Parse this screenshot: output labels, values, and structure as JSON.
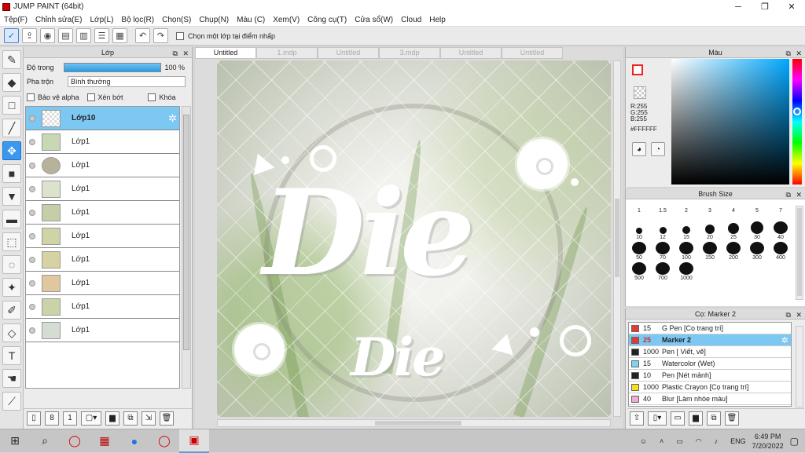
{
  "window": {
    "title": "JUMP PAINT (64bit)",
    "min": "─",
    "max": "❐",
    "close": "✕"
  },
  "menu": [
    "Tệp(F)",
    "Chỉnh sửa(E)",
    "Lớp(L)",
    "Bộ lọc(R)",
    "Chọn(S)",
    "Chụp(N)",
    "Màu (C)",
    "Xem(V)",
    "Công cụ(T)",
    "Cửa sổ(W)",
    "Cloud",
    "Help"
  ],
  "toolbar": {
    "select_layer_label": "Chọn một lớp tại điểm nhấp"
  },
  "layer_panel": {
    "title": "Lớp",
    "opacity_label": "Độ trong",
    "opacity_value": "100 %",
    "opacity": 100,
    "blend_label": "Pha trộn",
    "blend_value": "Bình thường",
    "protect_alpha": "Bảo vệ alpha",
    "clip": "Xén bớt",
    "lock": "Khóa",
    "layers": [
      {
        "name": "Lớp10",
        "active": true
      },
      {
        "name": "Lớp1"
      },
      {
        "name": "Lớp1"
      },
      {
        "name": "Lớp1"
      },
      {
        "name": "Lớp1"
      },
      {
        "name": "Lớp1"
      },
      {
        "name": "Lớp1"
      },
      {
        "name": "Lớp1"
      },
      {
        "name": "Lớp1"
      },
      {
        "name": "Lớp1"
      }
    ]
  },
  "tabs": [
    {
      "label": "Untitled",
      "active": true
    },
    {
      "label": "1.mdp"
    },
    {
      "label": "Untitled"
    },
    {
      "label": "3.mdp"
    },
    {
      "label": "Untitled"
    },
    {
      "label": "Untitled"
    }
  ],
  "canvas": {
    "main_text": "Die",
    "sub_text": "Die"
  },
  "color_panel": {
    "title": "Màu",
    "r": "R:255",
    "g": "G:255",
    "b": "B:255",
    "hex": "#FFFFFF"
  },
  "brush_panel": {
    "title": "Brush Size",
    "sizes": [
      "1",
      "1.5",
      "2",
      "3",
      "4",
      "5",
      "7",
      "10",
      "12",
      "15",
      "20",
      "25",
      "30",
      "40",
      "50",
      "70",
      "100",
      "150",
      "200",
      "300",
      "400",
      "500",
      "700",
      "1000"
    ]
  },
  "subtool_panel": {
    "title": "Cọ: Marker 2",
    "items": [
      {
        "size": "15",
        "name": "G Pen [Cọ trang trí]",
        "color": "#e53935"
      },
      {
        "size": "25",
        "name": "Marker 2",
        "color": "#e53935",
        "active": true
      },
      {
        "size": "1000",
        "name": "Pen [ Viết, vẽ]",
        "color": "#222222"
      },
      {
        "size": "15",
        "name": "Watercolor (Wet)",
        "color": "#7dd3f0"
      },
      {
        "size": "10",
        "name": "Pen [Nét mảnh]",
        "color": "#222222"
      },
      {
        "size": "1000",
        "name": "Plastic Crayon [Cọ trang trí]",
        "color": "#f2e01d"
      },
      {
        "size": "40",
        "name": "Blur [Làm nhòe màu]",
        "color": "#f4a8d4"
      }
    ]
  },
  "taskbar": {
    "lang": "ENG",
    "time": "6:49 PM",
    "date": "7/20/2022"
  }
}
